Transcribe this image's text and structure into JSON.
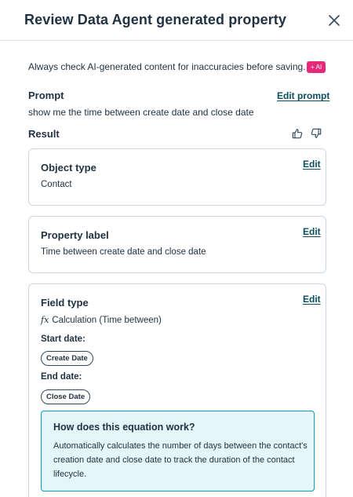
{
  "header": {
    "title": "Review Data Agent generated property",
    "close_icon": "close-icon"
  },
  "disclaimer": {
    "text": "Always check AI-generated content for inaccuracies before saving.",
    "badge": "AI",
    "badge_icon": "sparkle-plus-icon",
    "badge_color": "#e6297b"
  },
  "prompt": {
    "label": "Prompt",
    "edit_label": "Edit prompt",
    "text": "show me the time between create date and close date"
  },
  "result": {
    "label": "Result",
    "feedback_icons": [
      "thumbs-up-icon",
      "thumbs-down-icon"
    ]
  },
  "cards": {
    "object_type": {
      "title": "Object type",
      "value": "Contact",
      "edit_label": "Edit"
    },
    "property_label": {
      "title": "Property label",
      "value": "Time between create date and close date",
      "edit_label": "Edit"
    },
    "field_type": {
      "title": "Field type",
      "fx_symbol": "fx",
      "value": "Calculation (Time between)",
      "edit_label": "Edit",
      "start_label": "Start date:",
      "start_value": "Create Date",
      "end_label": "End date:",
      "end_value": "Close Date",
      "info": {
        "title": "How does this equation work?",
        "text": "Automatically calculates the number of days between the contact's creation date and close date to track the duration of the contact lifecycle."
      }
    }
  },
  "colors": {
    "link": "#0b4e5d",
    "text": "#213343",
    "border": "#cbd6e2",
    "info_bg": "#e5f5f8",
    "info_border": "#00a4bd"
  }
}
